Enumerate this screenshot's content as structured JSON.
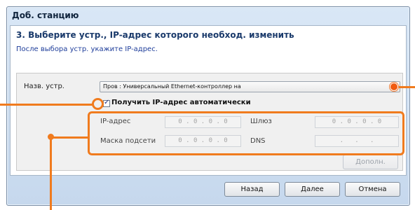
{
  "window": {
    "title": "Доб. станцию",
    "heading": "3. Выберите устр., IP-адрес которого необход. изменить",
    "subheading": "После выбора устр. укажите IP-адрес."
  },
  "device": {
    "label": "Назв. устр.",
    "selected": "Пров : Универсальный Ethernet-контроллер на"
  },
  "auto_ip": {
    "checked": true,
    "label": "Получить IP-адрес автоматически"
  },
  "fields": {
    "ip_label": "IP-адрес",
    "ip_value": "0 . 0 . 0 . 0",
    "gateway_label": "Шлюз",
    "gateway_value": "0 . 0 . 0 . 0",
    "mask_label": "Маска подсети",
    "mask_value": "0 . 0 . 0 . 0",
    "dns_label": "DNS",
    "dns_value": " .   .   . "
  },
  "buttons": {
    "advanced": "Дополн.",
    "back": "Назад",
    "next": "Далее",
    "cancel": "Отмена"
  },
  "colors": {
    "highlight": "#f07b1e",
    "accent_text": "#1e3d9a"
  }
}
